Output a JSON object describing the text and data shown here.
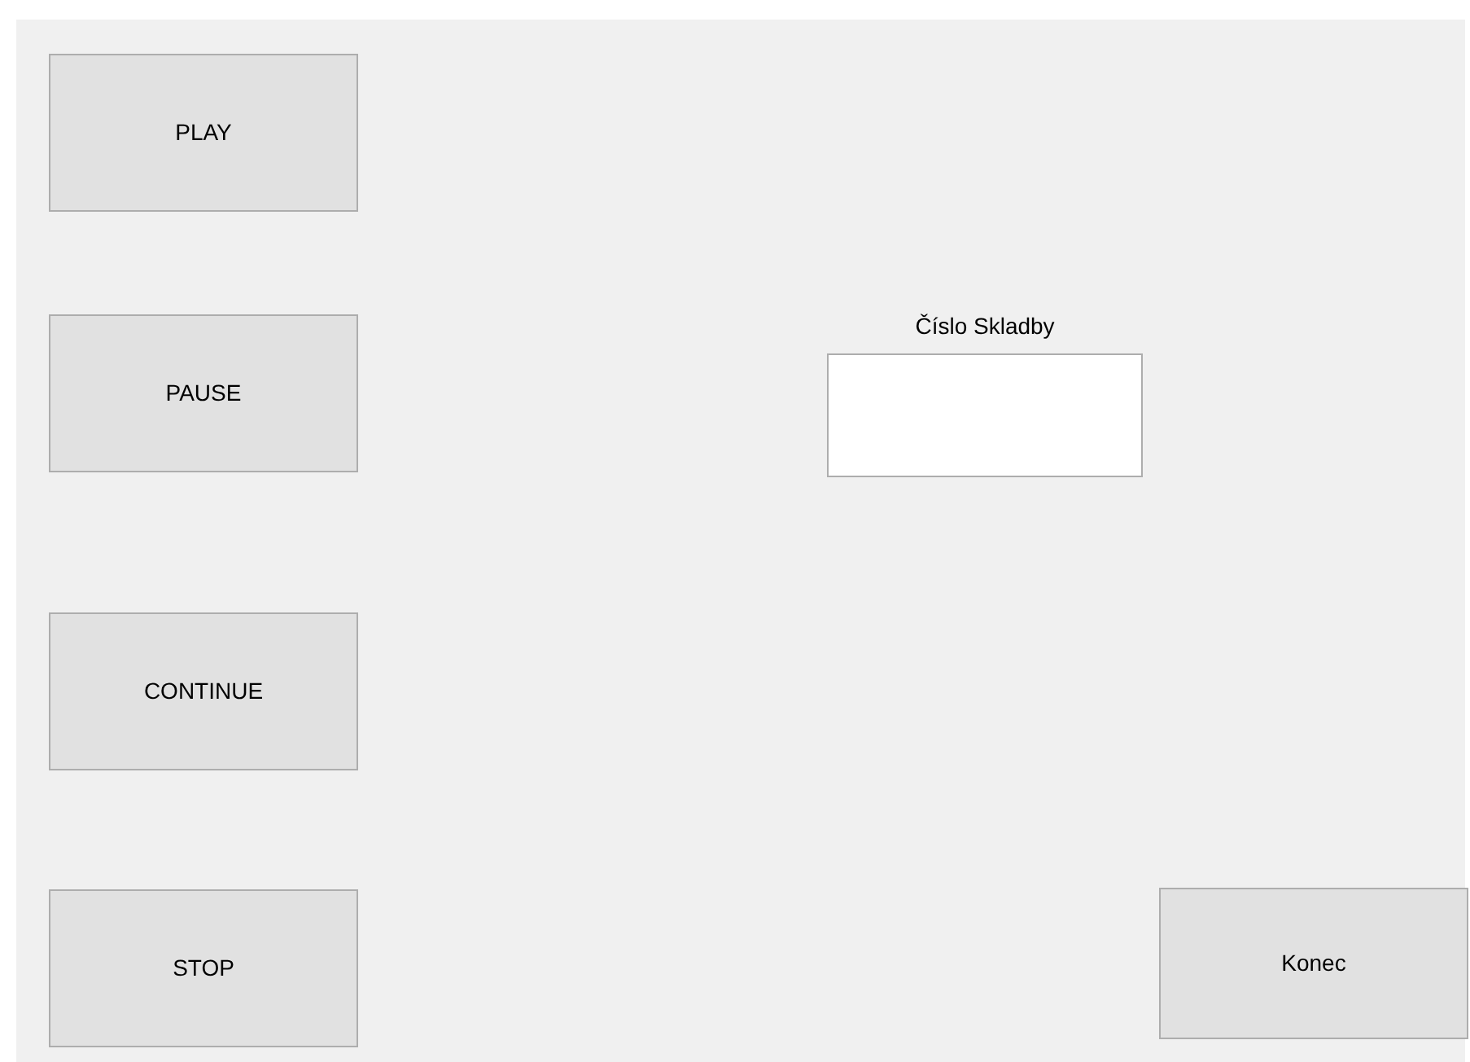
{
  "control_buttons": [
    {
      "label": "PLAY"
    },
    {
      "label": "PAUSE"
    },
    {
      "label": "CONTINUE"
    },
    {
      "label": "STOP"
    }
  ],
  "track_field": {
    "label": "Číslo Skladby"
  },
  "exit_button": {
    "label": "Konec"
  }
}
